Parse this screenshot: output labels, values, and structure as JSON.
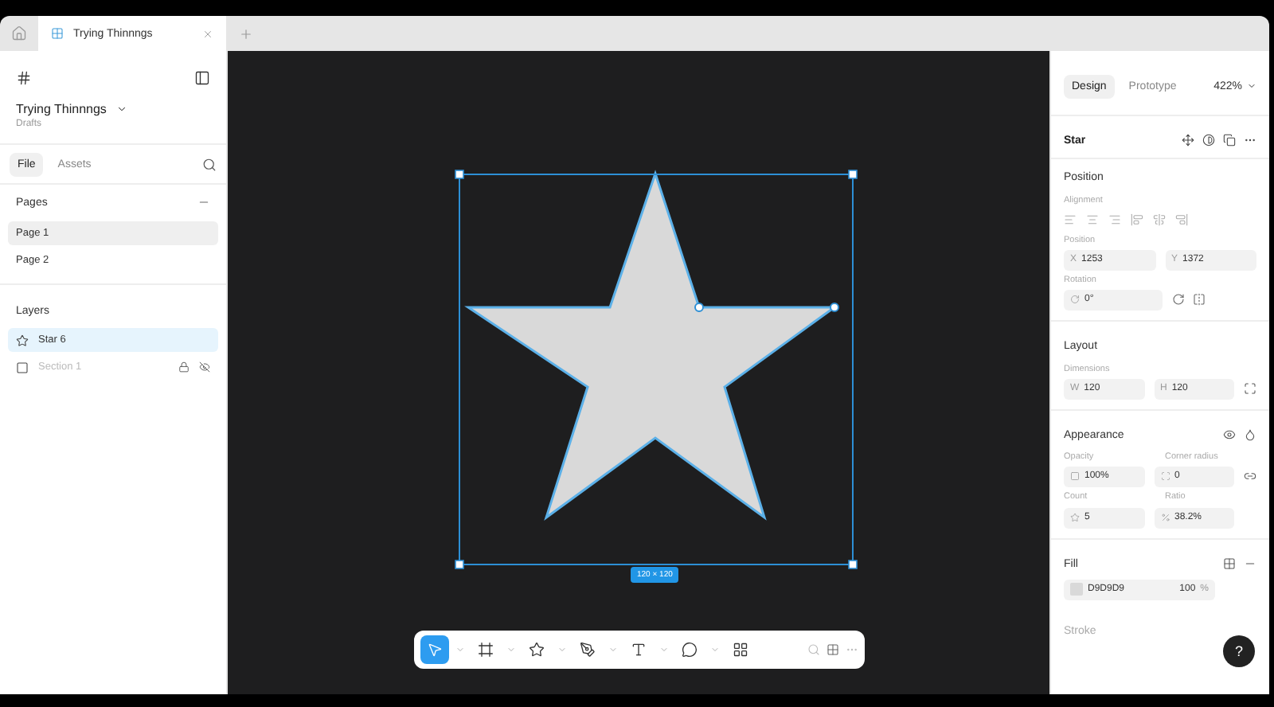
{
  "browser_tabs": [
    {
      "title": "Trying Thinnngs",
      "selected": true
    }
  ],
  "sidebar": {
    "file_name": "Trying Thinnngs",
    "project": "Drafts",
    "tabs": [
      {
        "label": "File",
        "selected": true
      },
      {
        "label": "Assets",
        "selected": false
      }
    ],
    "pages_heading": "Pages",
    "pages": [
      {
        "label": "Page 1",
        "selected": true
      },
      {
        "label": "Page 2",
        "selected": false
      }
    ],
    "layers_heading": "Layers",
    "layers": [
      {
        "name": "Star 6",
        "kind": "star",
        "selected": true,
        "locked": false
      },
      {
        "name": "Section 1",
        "kind": "frame",
        "selected": false,
        "locked": true
      }
    ]
  },
  "canvas": {
    "selection_size": "120 × 120"
  },
  "toolbar": {
    "tools": [
      {
        "kind": "pointer",
        "selected": true
      },
      {
        "kind": "frame",
        "selected": false
      },
      {
        "kind": "star",
        "selected": false
      },
      {
        "kind": "pen",
        "selected": false
      },
      {
        "kind": "text",
        "selected": false
      },
      {
        "kind": "comment",
        "selected": false
      },
      {
        "kind": "actions",
        "selected": false
      }
    ]
  },
  "design_panel": {
    "tabs": [
      {
        "label": "Design",
        "selected": true
      },
      {
        "label": "Prototype",
        "selected": false
      }
    ],
    "zoom": "422%",
    "layer_title": "Star",
    "position": {
      "heading": "Position",
      "alignment_label": "Alignment",
      "position_label": "Position",
      "x": {
        "prefix": "X",
        "value": "1253"
      },
      "y": {
        "prefix": "Y",
        "value": "1372"
      },
      "rotation_label": "Rotation",
      "rotation": "0°"
    },
    "layout": {
      "heading": "Layout",
      "dimensions_label": "Dimensions",
      "w": {
        "prefix": "W",
        "value": "120"
      },
      "h": {
        "prefix": "H",
        "value": "120"
      }
    },
    "appearance": {
      "heading": "Appearance",
      "opacity_label": "Opacity",
      "opacity": "100%",
      "corner_label": "Corner radius",
      "corner": "0",
      "count_label": "Count",
      "count": "5",
      "ratio_label": "Ratio",
      "ratio": "38.2%"
    },
    "fill": {
      "heading": "Fill",
      "hex": "D9D9D9",
      "opacity": "100",
      "unit": "%"
    },
    "stroke_heading": "Stroke"
  },
  "help_button": "?"
}
